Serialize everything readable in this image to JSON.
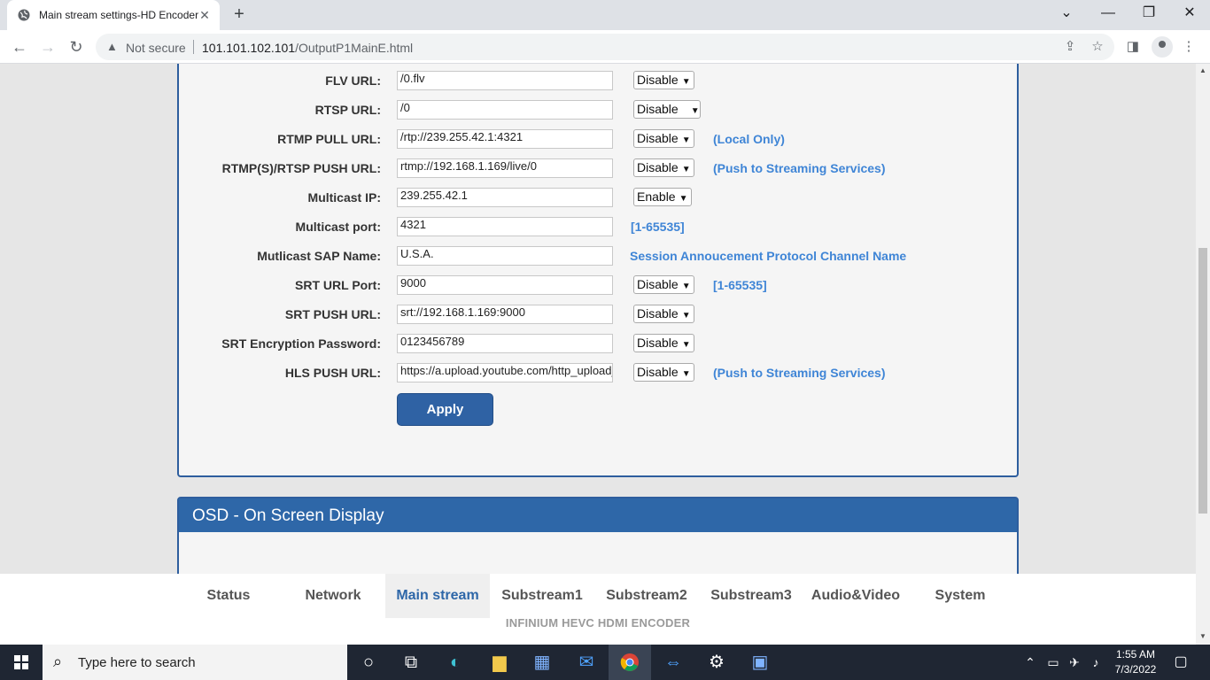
{
  "browser": {
    "tab_title": "Main stream settings-HD Encoder",
    "tab_close": "✕",
    "new_tab": "+",
    "not_secure": "Not secure",
    "url_host": "101.101.102.101",
    "url_path": "/OutputP1MainE.html"
  },
  "form": {
    "rows": [
      {
        "label": "FLV URL:",
        "value": "/0.flv",
        "select": "Disable",
        "hint": ""
      },
      {
        "label": "RTSP URL:",
        "value": "/0",
        "select": "Disable",
        "hint": ""
      },
      {
        "label": "RTMP PULL URL:",
        "value": "/rtp://239.255.42.1:4321",
        "select": "Disable",
        "hint": "(Local Only)"
      },
      {
        "label": "RTMP(S)/RTSP PUSH URL:",
        "value": "rtmp://192.168.1.169/live/0",
        "select": "Disable",
        "hint": "(Push to Streaming Services)"
      },
      {
        "label": "Multicast IP:",
        "value": "239.255.42.1",
        "select": "Enable",
        "hint": ""
      },
      {
        "label": "Multicast port:",
        "value": "4321",
        "select": "",
        "hint": "[1-65535]"
      },
      {
        "label": "Mutlicast SAP Name:",
        "value": "U.S.A.",
        "select": "",
        "hint": "Session Annoucement Protocol Channel Name"
      },
      {
        "label": "SRT URL Port:",
        "value": "9000",
        "select": "Disable",
        "hint": "[1-65535]"
      },
      {
        "label": "SRT PUSH URL:",
        "value": "srt://192.168.1.169:9000",
        "select": "Disable",
        "hint": ""
      },
      {
        "label": "SRT Encryption Password:",
        "value": "0123456789",
        "select": "Disable",
        "hint": ""
      },
      {
        "label": "HLS PUSH URL:",
        "value": "https://a.upload.youtube.com/http_upload_hls",
        "select": "Disable",
        "hint": "(Push to Streaming Services)"
      }
    ],
    "apply_label": "Apply"
  },
  "osd": {
    "title": "OSD - On Screen Display"
  },
  "nav": {
    "items": [
      "Status",
      "Network",
      "Main stream",
      "Substream1",
      "Substream2",
      "Substream3",
      "Audio&Video",
      "System"
    ],
    "active": "Main stream",
    "brand": "INFINIUM HEVC HDMI ENCODER"
  },
  "taskbar": {
    "search_placeholder": "Type here to search",
    "time": "1:55 AM",
    "date": "7/3/2022"
  }
}
